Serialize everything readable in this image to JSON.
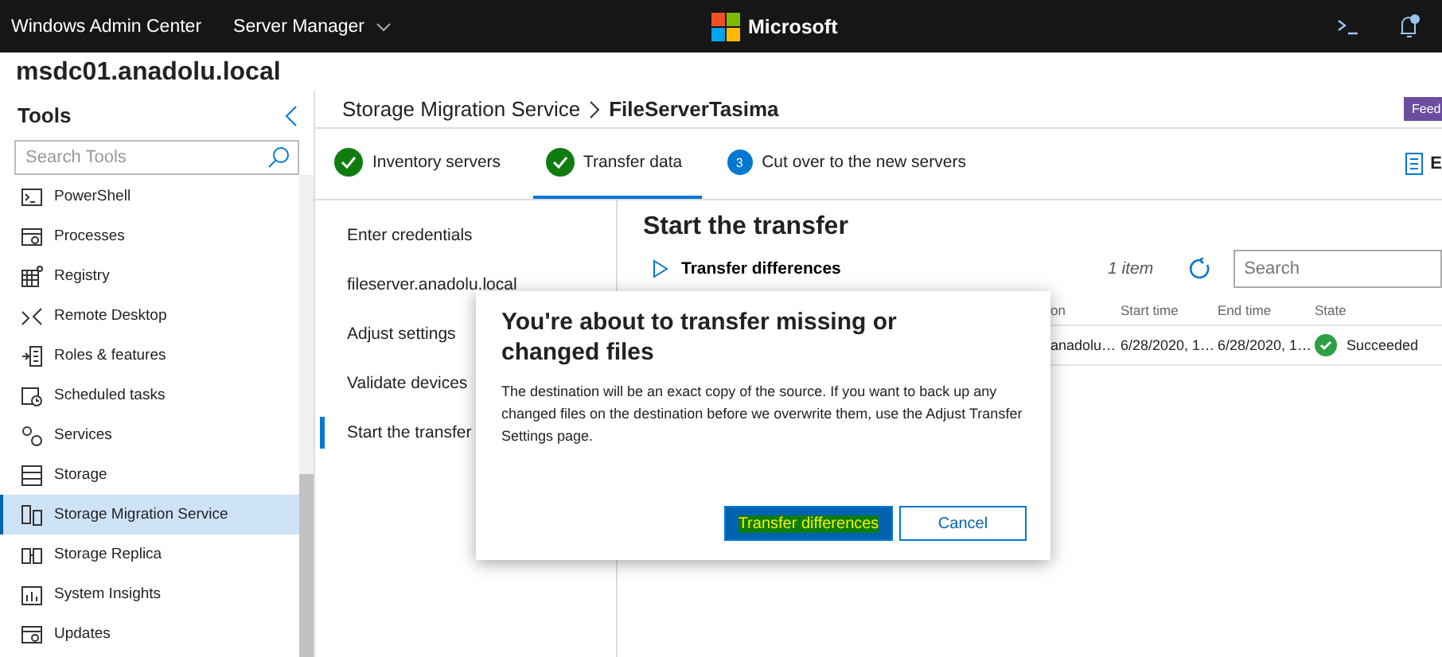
{
  "top_bar": {
    "app_title": "Windows Admin Center",
    "context_menu": "Server Manager",
    "brand": "Microsoft"
  },
  "server_name": "msdc01.anadolu.local",
  "sidebar": {
    "title": "Tools",
    "search": {
      "placeholder": "Search Tools"
    },
    "items": [
      {
        "label": "PowerShell",
        "selected": false
      },
      {
        "label": "Processes",
        "selected": false
      },
      {
        "label": "Registry",
        "selected": false
      },
      {
        "label": "Remote Desktop",
        "selected": false
      },
      {
        "label": "Roles & features",
        "selected": false
      },
      {
        "label": "Scheduled tasks",
        "selected": false
      },
      {
        "label": "Services",
        "selected": false
      },
      {
        "label": "Storage",
        "selected": false
      },
      {
        "label": "Storage Migration Service",
        "selected": true
      },
      {
        "label": "Storage Replica",
        "selected": false
      },
      {
        "label": "System Insights",
        "selected": false
      },
      {
        "label": "Updates",
        "selected": false
      }
    ]
  },
  "breadcrumb": {
    "parent": "Storage Migration Service",
    "current": "FileServerTasima"
  },
  "feedback_button": "Feed",
  "steps": [
    {
      "label": "Inventory servers",
      "completed": true,
      "selected": false
    },
    {
      "label": "Transfer data",
      "completed": true,
      "selected": true
    },
    {
      "label": "Cut over to the new servers",
      "completed": false,
      "number": "3",
      "selected": false
    }
  ],
  "step_side_action": "E",
  "substeps": [
    {
      "label": "Enter credentials",
      "selected": false
    },
    {
      "label": "fileserver.anadolu.local",
      "selected": false
    },
    {
      "label": "Adjust settings",
      "selected": false
    },
    {
      "label": "Validate devices",
      "selected": false
    },
    {
      "label": "Start the transfer",
      "selected": true
    }
  ],
  "content": {
    "title": "Start the transfer",
    "section": "Transfer differences",
    "expanded": false,
    "item_count": "1 item",
    "search": {
      "placeholder": "Search"
    },
    "table": {
      "columns": [
        "on",
        "Start time",
        "End time",
        "State"
      ],
      "rows": [
        {
          "cells": [
            "anadolu…",
            "6/28/2020, 1…",
            "6/28/2020, 1…"
          ],
          "state": "Succeeded",
          "succeeded": true
        }
      ]
    }
  },
  "dialog": {
    "title": "You're about to transfer missing or changed files",
    "body": "The destination will be an exact copy of the source. If you want to back up any changed files on the destination before we overwrite them, use the Adjust Transfer Settings page.",
    "buttons": [
      {
        "label": "Transfer differences",
        "kind": "primary"
      },
      {
        "label": "Cancel",
        "kind": "secondary"
      }
    ]
  }
}
